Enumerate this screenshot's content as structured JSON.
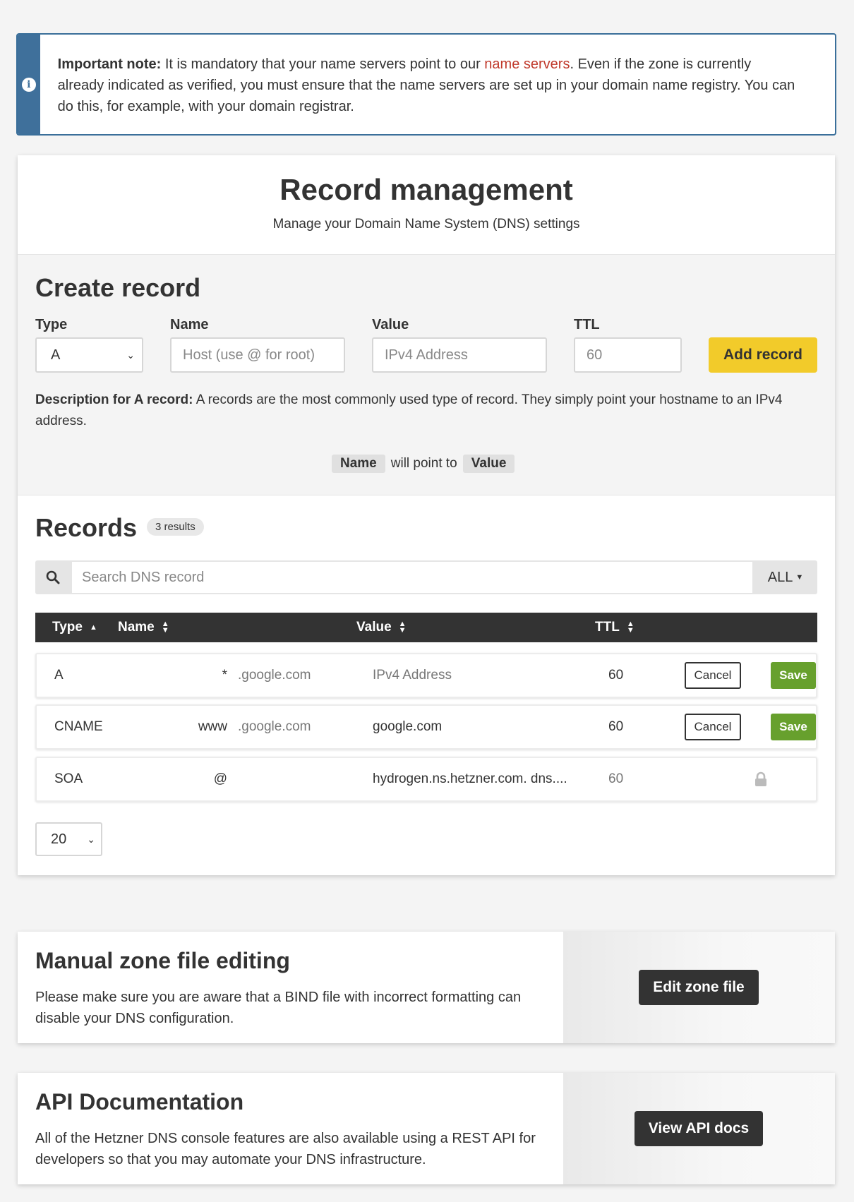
{
  "note": {
    "label": "Important note:",
    "text_before": " It is mandatory that your name servers point to our ",
    "link": "name servers",
    "text_after": ". Even if the zone is currently already indicated as verified, you must ensure that the name servers are set up in your domain name registry. You can do this, for example, with your domain registrar.",
    "icon": "info-icon"
  },
  "header": {
    "title": "Record management",
    "subtitle": "Manage your Domain Name System (DNS) settings"
  },
  "create": {
    "title": "Create record",
    "type_label": "Type",
    "type_value": "A",
    "name_label": "Name",
    "name_placeholder": "Host (use @ for root)",
    "value_label": "Value",
    "value_placeholder": "IPv4 Address",
    "ttl_label": "TTL",
    "ttl_placeholder": "60",
    "add_button": "Add record",
    "desc_label": "Description for A record:",
    "desc_text": " A records are the most commonly used type of record. They simply point your hostname to an IPv4 address.",
    "pointer_name": "Name",
    "pointer_text": "will point to",
    "pointer_value": "Value"
  },
  "records": {
    "title": "Records",
    "count": "3 results",
    "search_placeholder": "Search DNS record",
    "filter": "ALL",
    "columns": {
      "type": "Type",
      "name": "Name",
      "value": "Value",
      "ttl": "TTL"
    },
    "rows": [
      {
        "type": "A",
        "name": "*",
        "suffix": ".google.com",
        "value": "IPv4 Address",
        "ttl": "60",
        "cancel": "Cancel",
        "save": "Save"
      },
      {
        "type": "CNAME",
        "name": "www",
        "suffix": ".google.com",
        "value": "google.com",
        "ttl": "60",
        "cancel": "Cancel",
        "save": "Save"
      },
      {
        "type": "SOA",
        "name": "@",
        "suffix": "",
        "value": "hydrogen.ns.hetzner.com. dns....",
        "ttl": "60"
      }
    ],
    "page_size": "20"
  },
  "zone": {
    "title": "Manual zone file editing",
    "text": "Please make sure you are aware that a BIND file with incorrect formatting can disable your DNS configuration.",
    "button": "Edit zone file"
  },
  "api": {
    "title": "API Documentation",
    "text": "All of the Hetzner DNS console features are also available using a REST API for developers so that you may automate your DNS infrastructure.",
    "button": "View API docs"
  },
  "colors": {
    "note_accent": "#3f709b",
    "link": "#c0392b",
    "add_button": "#f2cb2a",
    "save_button": "#67a02d",
    "table_header": "#333333"
  }
}
